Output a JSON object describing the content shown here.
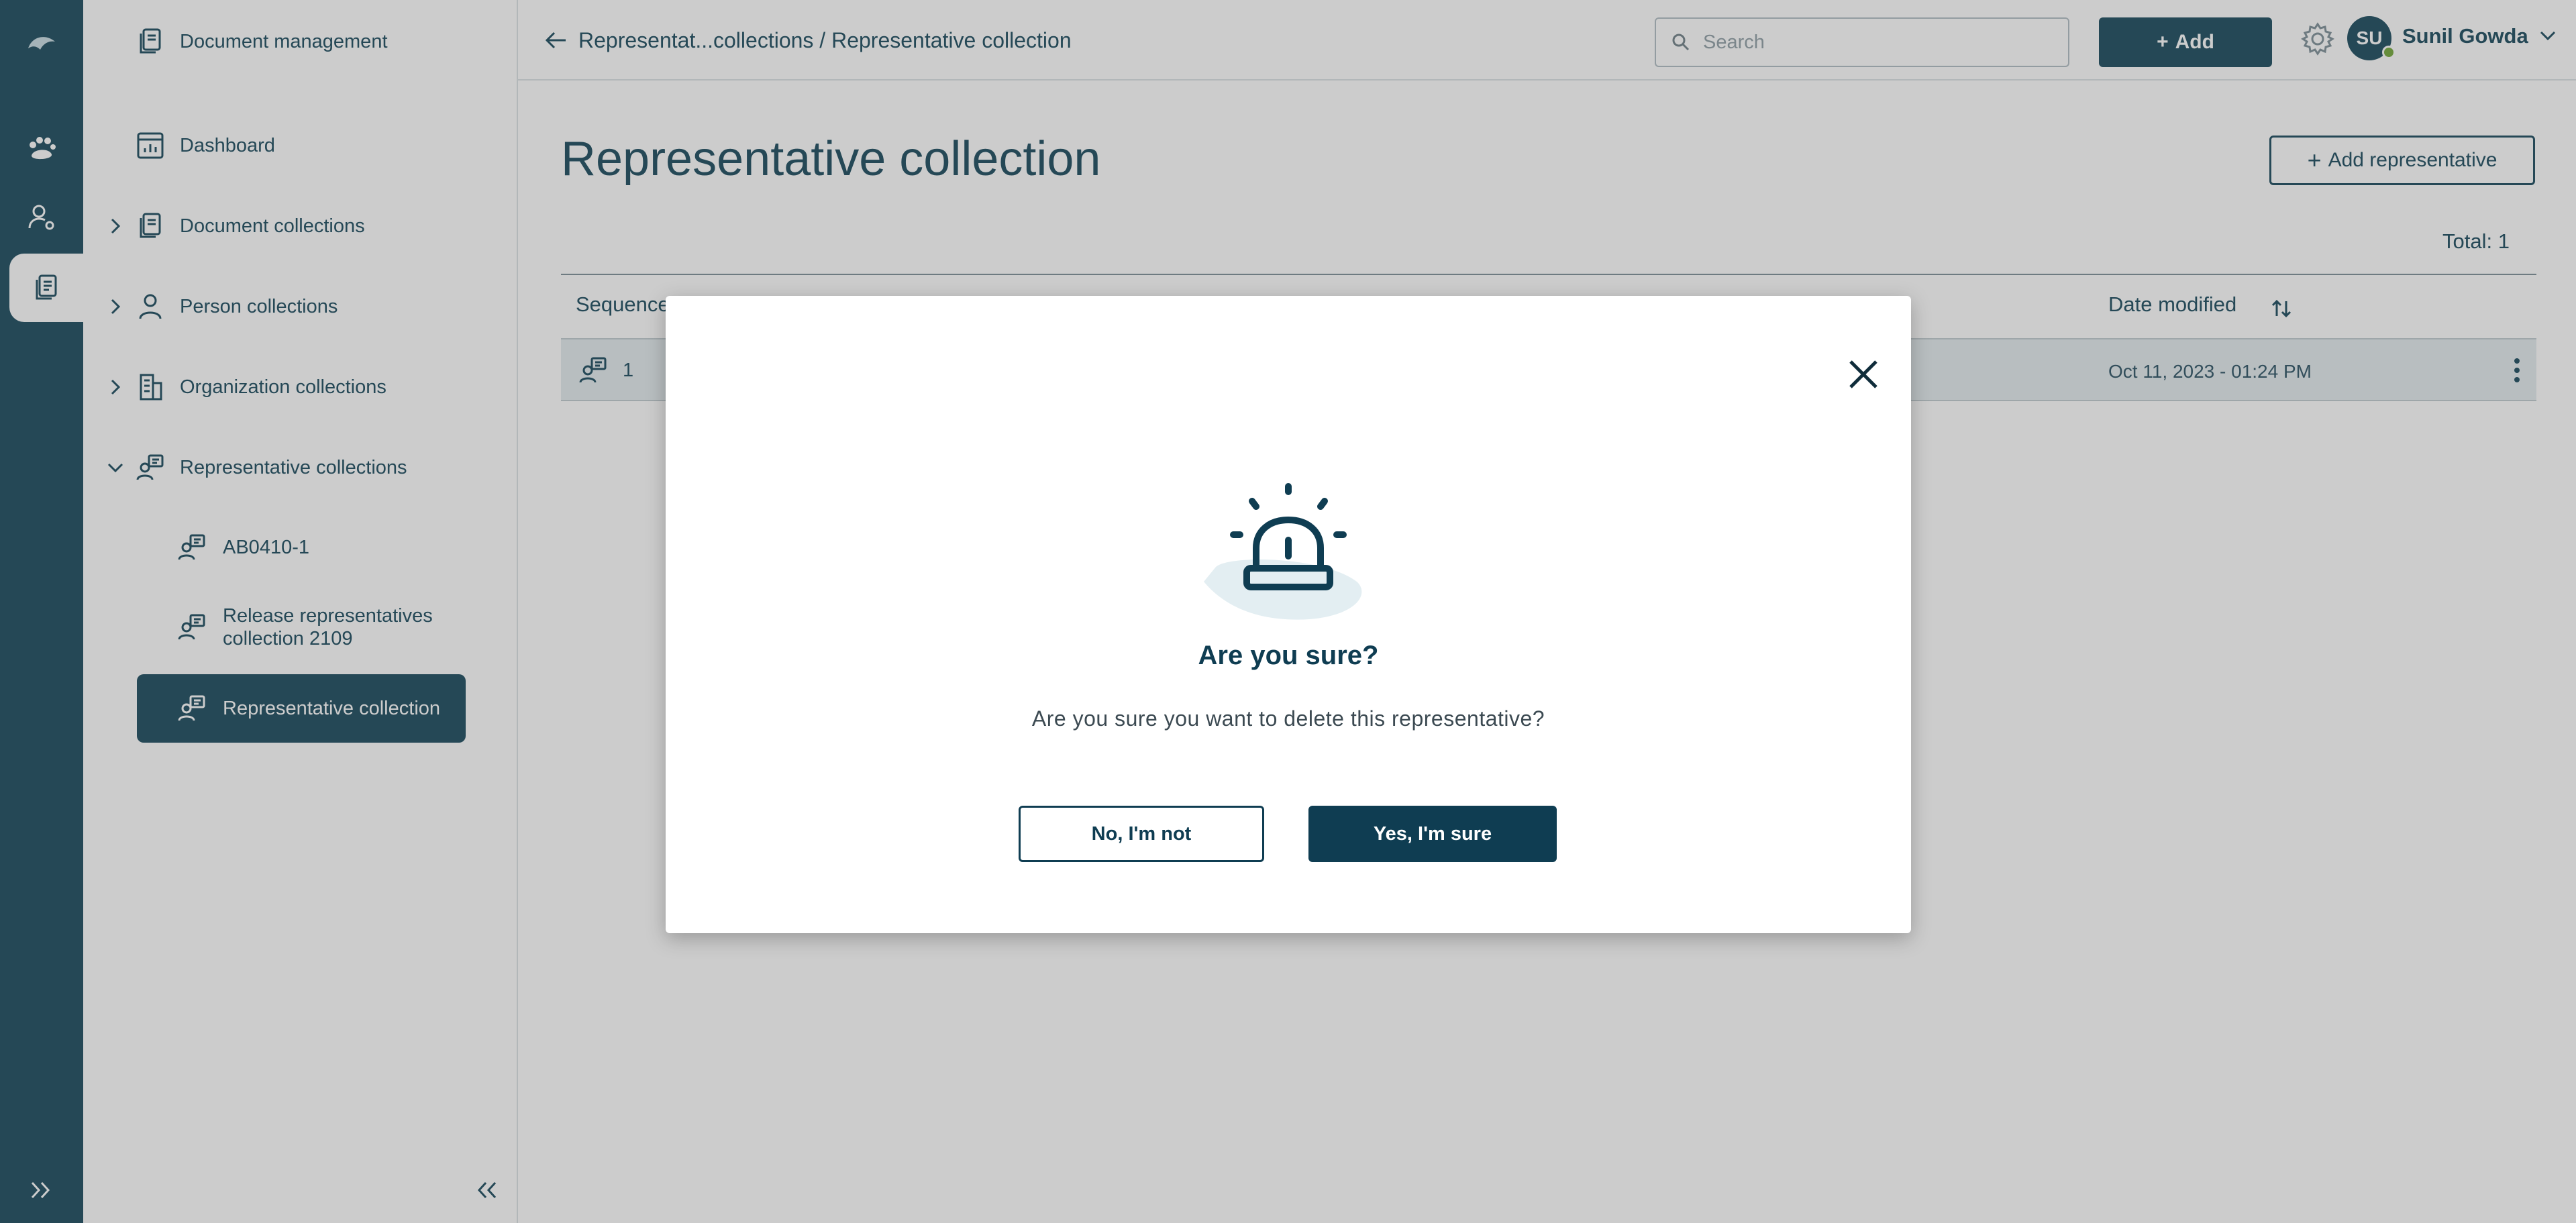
{
  "sidebar": {
    "title": "Document management",
    "items": [
      {
        "label": "Dashboard"
      },
      {
        "label": "Document collections"
      },
      {
        "label": "Person collections"
      },
      {
        "label": "Organization collections"
      },
      {
        "label": "Representative collections"
      }
    ],
    "subitems": [
      {
        "label": "AB0410-1"
      },
      {
        "label": "Release representatives collection 2109"
      },
      {
        "label": "Representative collection"
      }
    ]
  },
  "header": {
    "breadcrumb": "Representat...collections / Representative collection",
    "search_placeholder": "Search",
    "add_label": "Add",
    "user_initials": "SU",
    "user_name": "Sunil Gowda"
  },
  "main": {
    "title": "Representative collection",
    "add_representative_label": "Add representative",
    "total": "Total: 1",
    "columns": [
      "Sequence",
      "Date modified"
    ],
    "rows": [
      {
        "sequence": "1",
        "date_modified": "Oct 11, 2023 - 01:24 PM"
      }
    ]
  },
  "modal": {
    "title": "Are you sure?",
    "message": "Are you sure you want to delete this representative?",
    "no_label": "No, I'm not",
    "yes_label": "Yes, I'm sure"
  },
  "colors": {
    "brand": "#2f5b6c",
    "modal_primary": "#0f3d52",
    "status_online": "#7fb04a"
  }
}
